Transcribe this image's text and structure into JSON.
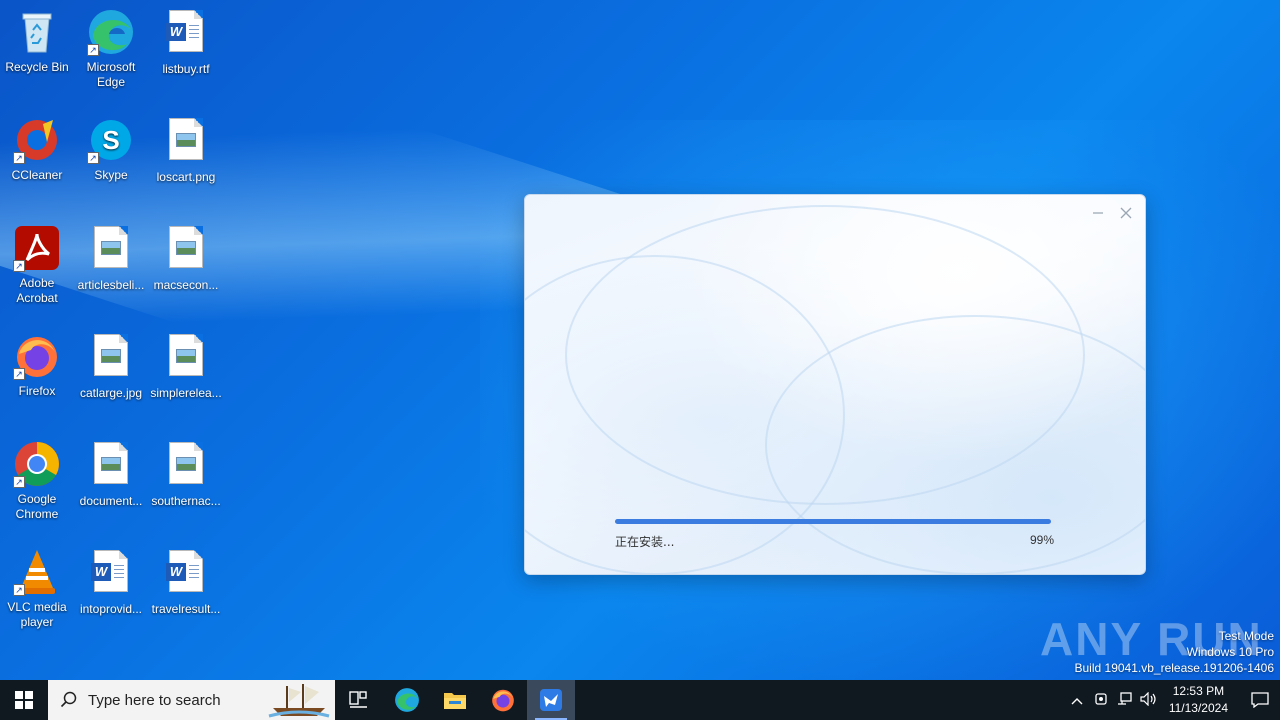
{
  "desktop": {
    "icons": [
      {
        "label": "Recycle Bin",
        "icon": "recycle-bin-icon"
      },
      {
        "label": "Microsoft Edge",
        "icon": "edge-icon"
      },
      {
        "label": "listbuy.rtf",
        "icon": "word-document-icon"
      },
      {
        "label": "CCleaner",
        "icon": "ccleaner-icon"
      },
      {
        "label": "Skype",
        "icon": "skype-icon"
      },
      {
        "label": "loscart.png",
        "icon": "image-file-icon"
      },
      {
        "label": "Adobe Acrobat",
        "icon": "acrobat-icon"
      },
      {
        "label": "articlesbeli...",
        "icon": "image-file-icon"
      },
      {
        "label": "macsecon...",
        "icon": "image-file-icon"
      },
      {
        "label": "Firefox",
        "icon": "firefox-icon"
      },
      {
        "label": "catlarge.jpg",
        "icon": "image-file-icon"
      },
      {
        "label": "simplerelea...",
        "icon": "image-file-icon"
      },
      {
        "label": "Google Chrome",
        "icon": "chrome-icon"
      },
      {
        "label": "document...",
        "icon": "image-file-icon"
      },
      {
        "label": "southernac...",
        "icon": "image-file-icon"
      },
      {
        "label": "VLC media player",
        "icon": "vlc-icon"
      },
      {
        "label": "intoprovid...",
        "icon": "word-document-icon"
      },
      {
        "label": "travelresult...",
        "icon": "word-document-icon"
      }
    ]
  },
  "installer": {
    "status": "正在安装...",
    "percent_label": "99%",
    "progress_fraction": 0.99,
    "minimize_icon": "minimize-icon",
    "close_icon": "close-icon",
    "accent": "#3b7ce0"
  },
  "watermark": {
    "brand": "ANY RUN",
    "line1": "Test Mode",
    "line2": "Windows 10 Pro",
    "line3": "Build 19041.vb_release.191206-1406"
  },
  "taskbar": {
    "search_placeholder": "Type here to search",
    "time": "12:53 PM",
    "date": "11/13/2024",
    "apps": [
      "task-view-icon",
      "edge-icon",
      "file-explorer-icon",
      "firefox-icon",
      "installer-app-icon"
    ]
  }
}
